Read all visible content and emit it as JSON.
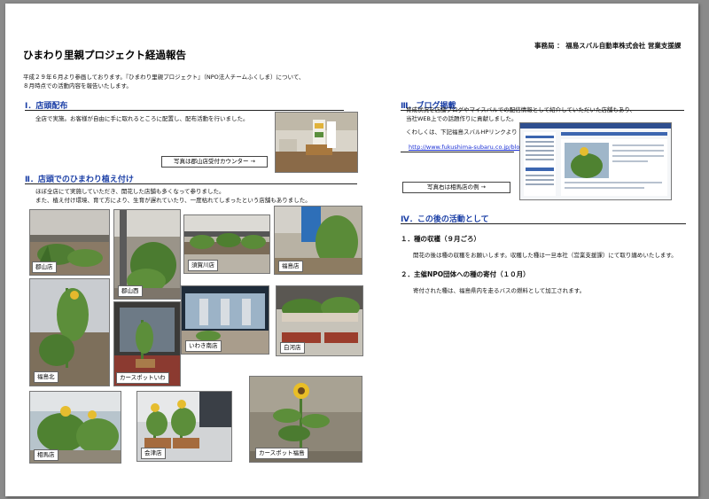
{
  "org": "事務局 ： 福島スバル自動車株式会社 営業支援課",
  "title": "ひまわり里親プロジェクト経過報告",
  "intro": {
    "line1": "平成２９年６月より参画しております。『ひまわり里親プロジェクト』（NPO法人チームふくしま）について、",
    "line2": "８月時点での活動内容を報告いたします。"
  },
  "section1": {
    "heading": "Ⅰ．店頭配布",
    "text": "全店で実施。お客様が自由に手に取れるところに配置し、配布活動を行いました。",
    "button": "写真は郡山店受付カウンター →"
  },
  "section2": {
    "heading": "Ⅱ．店頭でのひまわり植え付け",
    "line1": "ほぼ全店にて実施していただき、開花した店舗も多くなって参りました。",
    "line2": "また、植え付け環境、育て方により、生育が遅れていたり、一度枯れてしまったという店舗もありました。"
  },
  "photos": {
    "koriyama": "郡山店",
    "koriyama_nishi": "郡山西",
    "sukagawa": "須賀川店",
    "fukushima": "福島店",
    "fukushima_kita": "福島北",
    "carsport_iwaki": "カースポットいわ",
    "iwaki_minami": "いわき南店",
    "shirakawa": "白河店",
    "soma": "相馬店",
    "aizu": "会津店",
    "carsport_fukushima": "カースポット福島"
  },
  "section3": {
    "heading": "Ⅲ．ブログ掲載",
    "line1": "育成状況を店舗ブログやマイスバルでの配信情報として紹介していただいた店舗もあり、",
    "line2": "当社WEB上での話題作りに貢献しました。",
    "line3": "くわしくは、下記福島スバルHPリンクより",
    "link": "http://www.fukushima-subaru.co.jp/blo",
    "button": "写真右は相馬店の例 →"
  },
  "section4": {
    "heading": "Ⅳ．この後の活動として",
    "sub1": "１．種の収穫（９月ごろ）",
    "text1": "開花の後は種の収穫をお願いします。収穫した種は一旦本社（営業支援課）にて取り纏めいたします。",
    "sub2": "２．主催NPO団体への種の寄付（１０月）",
    "text2": "寄付された種は、福島県内を走るバスの燃料として加工されます。"
  },
  "colors": {
    "heading_blue": "#1b3fa6",
    "link_blue": "#1a2fd6"
  }
}
